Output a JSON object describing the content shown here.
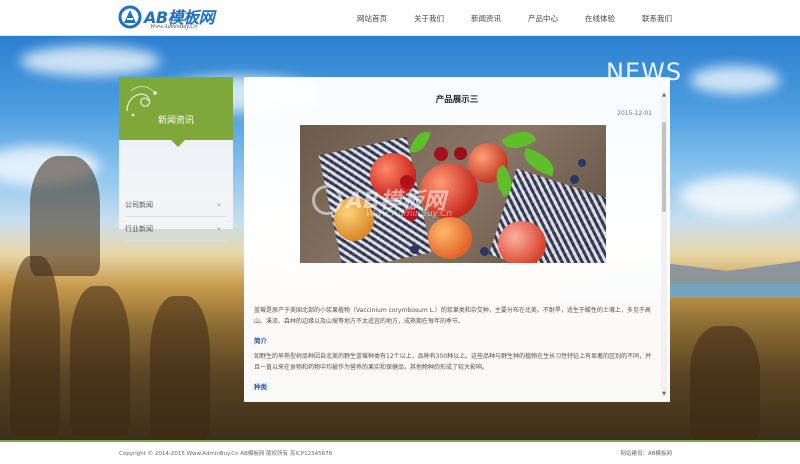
{
  "brand": {
    "name": "AB模板网",
    "tagline": "Www.AdminBuy.Cn",
    "color": "#1f6fc5"
  },
  "nav": {
    "items": [
      "网站首页",
      "关于我们",
      "新闻资讯",
      "产品中心",
      "在线体验",
      "联系我们"
    ]
  },
  "hero": {
    "watermark_title": "NEWS"
  },
  "sidebar": {
    "title": "新闻资讯",
    "accent_color": "#7fa83a",
    "items": [
      {
        "label": "公司新闻",
        "chevron": "»"
      },
      {
        "label": "行业新闻",
        "chevron": "»"
      }
    ]
  },
  "article": {
    "title": "产品展示三",
    "date": "2015-12-01",
    "image_watermark": {
      "title": "AB模板网",
      "sub": "Www.AdminBuy.Cn"
    },
    "paragraph_1": "蓝莓是原产于美国北部的小浆果植物（Vaccinium corymbosum L.）的浆果类和杂交种，主要分布在北美。不耐旱，适生于酸性的土壤上，多见于高山、溪流、森林的边缘以及山坡等地方不太适宜的地方，成熟期在每年的季节。",
    "subhead_1": "简介",
    "paragraph_2": "如野生的早熟型树品种因自北美的野生蓝莓种类有12个以上，品种有350种以上。这些品种与野生种的植物在生长习性特征上有显著的区别的不同，并且一直以来在食物和药物中均被作为营养的果实和保健品，其他物种的形成了较大影响。",
    "subhead_2": "种类"
  },
  "footer": {
    "copyright": "Copyright © 2014-2015 Www.AdminBuy.Cn AB模板网  版权所有  苏ICP12345678",
    "links": "网站建设：AB模板网"
  }
}
